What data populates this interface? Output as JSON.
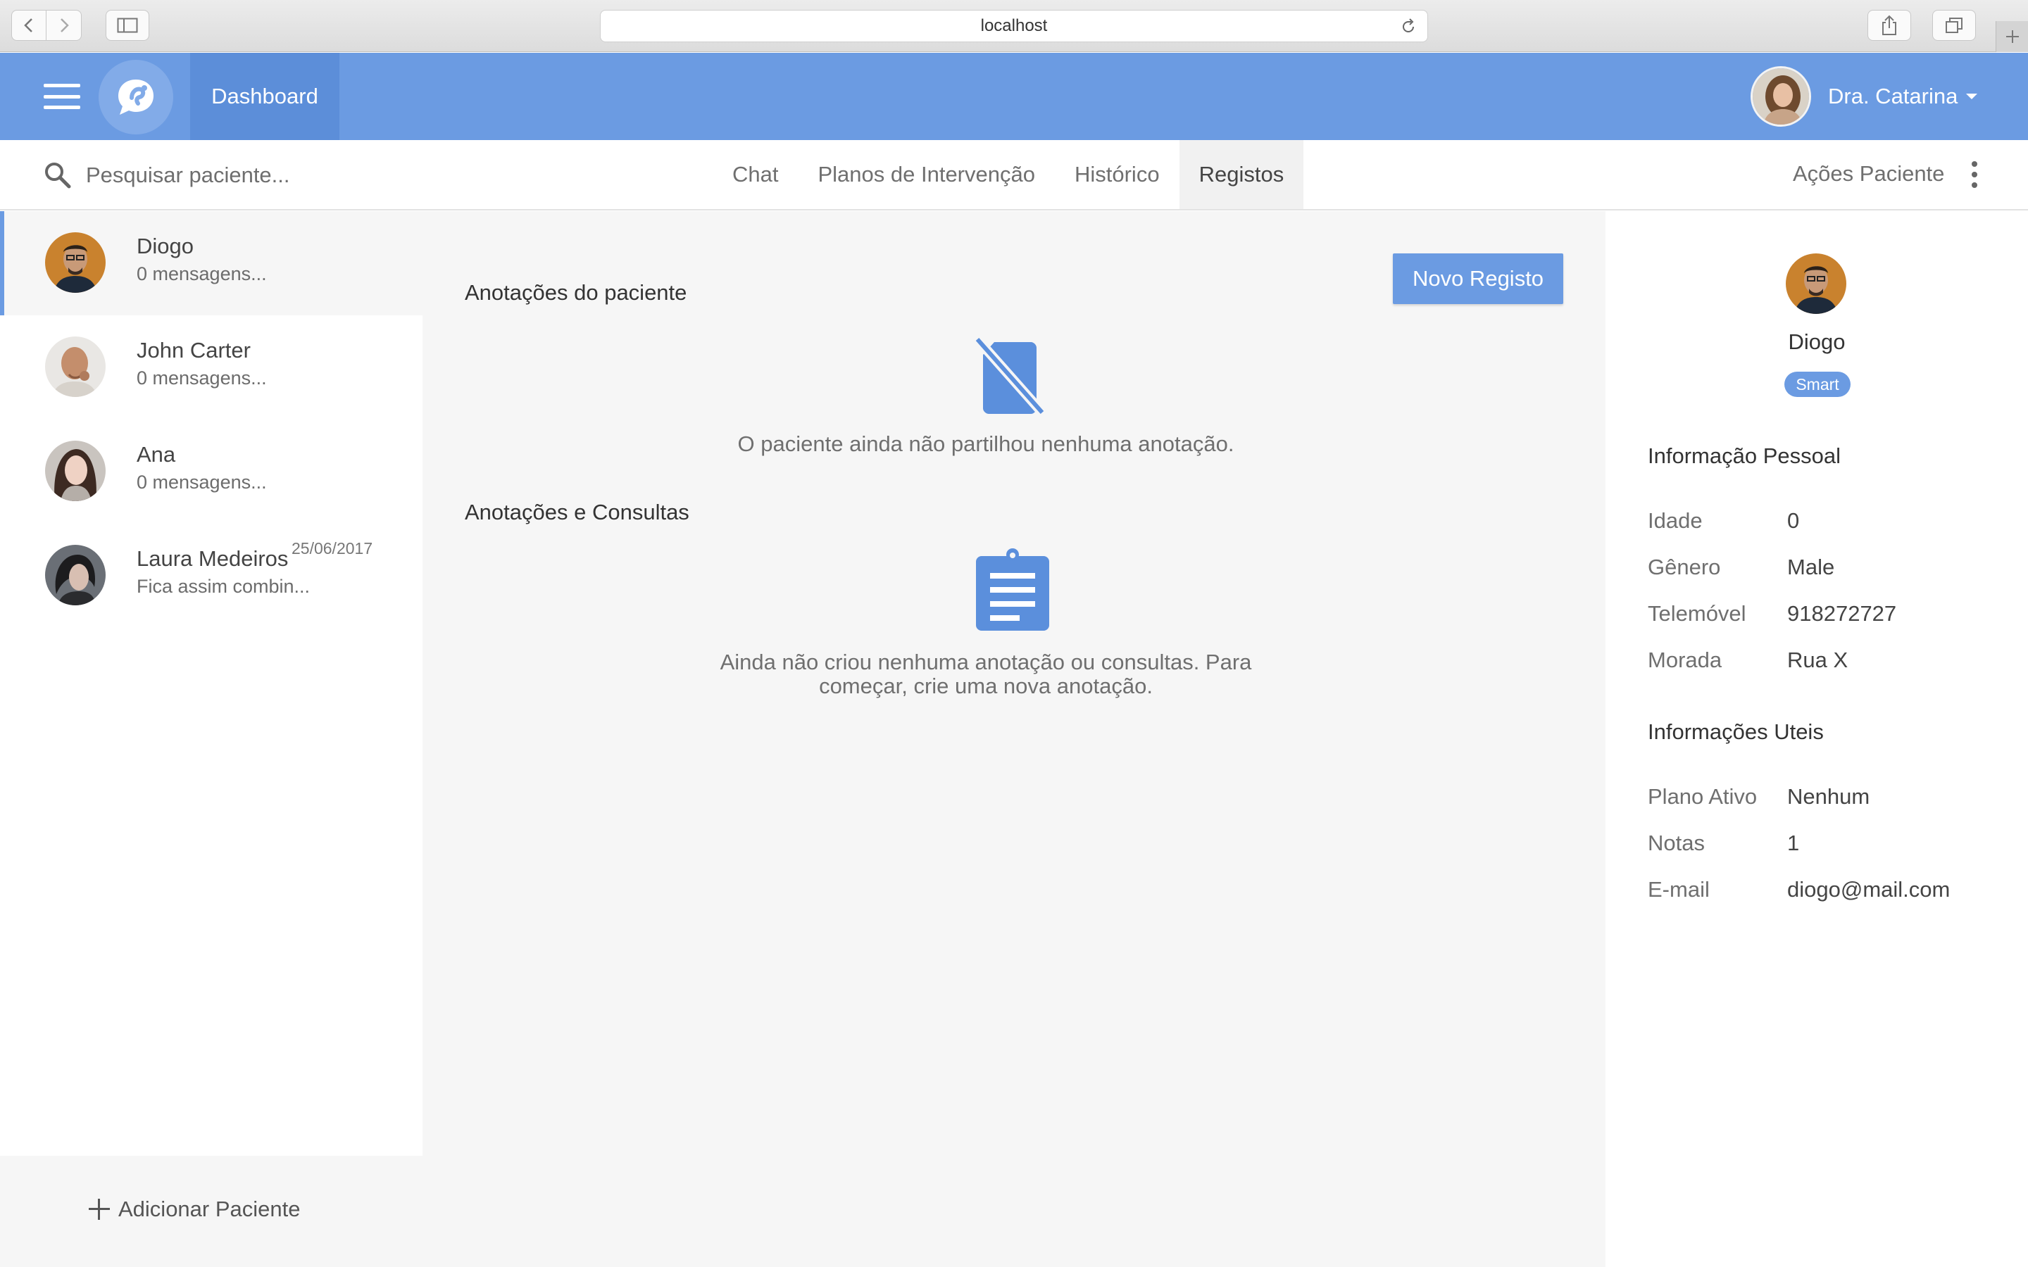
{
  "browser": {
    "url": "localhost"
  },
  "appbar": {
    "dashboard_label": "Dashboard",
    "user_name": "Dra. Catarina"
  },
  "subbar": {
    "search_placeholder": "Pesquisar paciente...",
    "tabs": [
      {
        "label": "Chat",
        "active": false
      },
      {
        "label": "Planos de Intervenção",
        "active": false
      },
      {
        "label": "Histórico",
        "active": false
      },
      {
        "label": "Registos",
        "active": true
      }
    ],
    "actions_label": "Ações Paciente"
  },
  "patients": [
    {
      "name": "Diogo",
      "preview": "0 mensagens...",
      "date": "",
      "active": true
    },
    {
      "name": "John Carter",
      "preview": "0 mensagens...",
      "date": ""
    },
    {
      "name": "Ana",
      "preview": "0 mensagens...",
      "date": ""
    },
    {
      "name": "Laura Medeiros",
      "preview": "Fica assim combin...",
      "date": "25/06/2017"
    }
  ],
  "add_patient_label": "Adicionar Paciente",
  "main": {
    "section1_title": "Anotações do paciente",
    "new_button_label": "Novo Registo",
    "section1_empty": "O paciente ainda não partilhou nenhuma anotação.",
    "section2_title": "Anotações e Consultas",
    "section2_empty": "Ainda não criou nenhuma anotação ou consultas. Para começar, crie uma nova anotação."
  },
  "info": {
    "name": "Diogo",
    "badge": "Smart",
    "personal_heading": "Informação Pessoal",
    "personal": [
      {
        "label": "Idade",
        "value": "0"
      },
      {
        "label": "Gênero",
        "value": "Male"
      },
      {
        "label": "Telemóvel",
        "value": "918272727"
      },
      {
        "label": "Morada",
        "value": "Rua X"
      }
    ],
    "useful_heading": "Informações Uteis",
    "useful": [
      {
        "label": "Plano Ativo",
        "value": "Nenhum"
      },
      {
        "label": "Notas",
        "value": "1"
      },
      {
        "label": "E-mail",
        "value": "diogo@mail.com"
      }
    ]
  },
  "colors": {
    "primary": "#6b9be2",
    "primary_dark": "#5c8ed9",
    "icon_blue": "#5b8fdc"
  }
}
